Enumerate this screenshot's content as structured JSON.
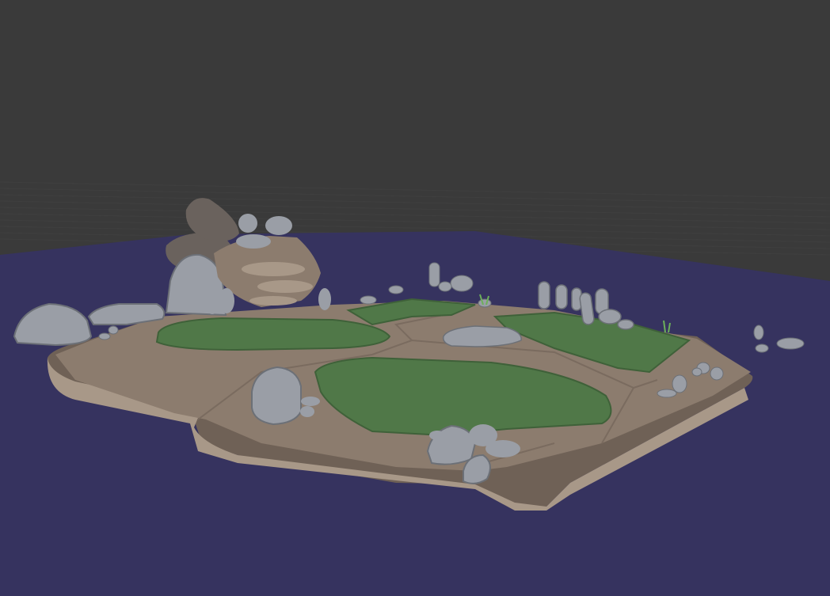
{
  "viewport": {
    "colors": {
      "background": "#3a3a3a",
      "floor_plane": "#36335f",
      "grid_line": "#454545",
      "dirt": "#8c7c6e",
      "dirt_shadow": "#6f6156",
      "dirt_highlight": "#a89888",
      "grass": "#507848",
      "grass_edge": "#3f6139",
      "rock": "#9a9ea6",
      "rock_shadow": "#6c7077",
      "rock_highlight": "#c3c6cc",
      "dark_rock": "#6a625d"
    }
  }
}
